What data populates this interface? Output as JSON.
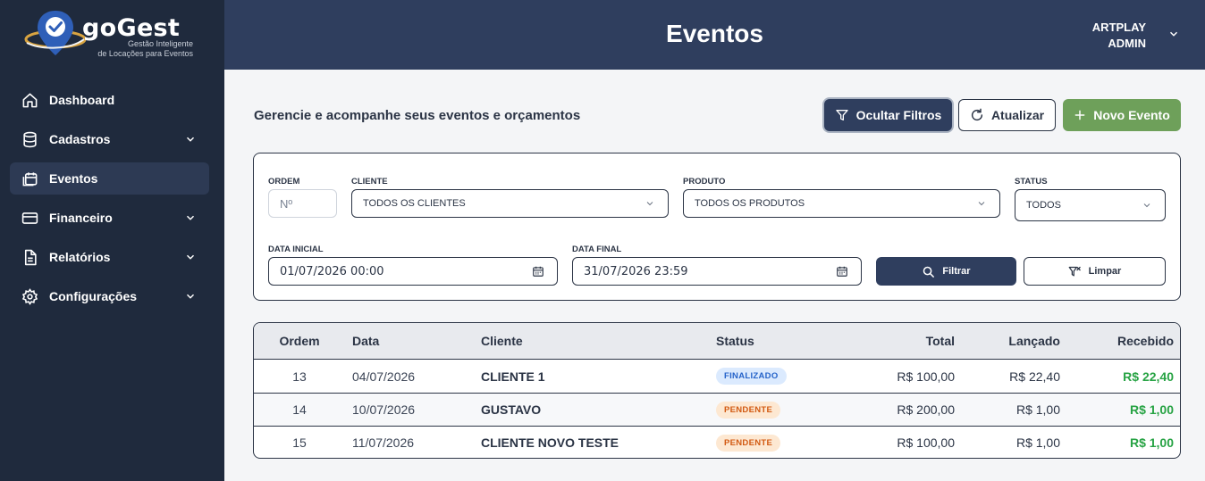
{
  "app": {
    "name": "goGest",
    "tagline_1": "Gestão Inteligente",
    "tagline_2": "de Locações para Eventos"
  },
  "sidebar": {
    "items": [
      {
        "label": "Dashboard",
        "icon": "home-icon"
      },
      {
        "label": "Cadastros",
        "icon": "database-icon",
        "expandable": true
      },
      {
        "label": "Eventos",
        "icon": "calendar-icon",
        "active": true
      },
      {
        "label": "Financeiro",
        "icon": "card-icon",
        "expandable": true
      },
      {
        "label": "Relatórios",
        "icon": "report-icon",
        "expandable": true
      },
      {
        "label": "Configurações",
        "icon": "gear-icon",
        "expandable": true
      }
    ]
  },
  "header": {
    "title": "Eventos",
    "user_name": "ARTPLAY",
    "user_role": "ADMIN"
  },
  "toolbar": {
    "subtitle": "Gerencie e acompanhe seus eventos e orçamentos",
    "hide_filters_label": "Ocultar Filtros",
    "refresh_label": "Atualizar",
    "new_event_label": "Novo Evento"
  },
  "filters": {
    "order_label": "ORDEM",
    "order_placeholder": "Nº",
    "client_label": "CLIENTE",
    "client_value": "TODOS OS CLIENTES",
    "product_label": "PRODUTO",
    "product_value": "TODOS OS PRODUTOS",
    "status_label": "STATUS",
    "status_value": "TODOS",
    "start_label": "DATA INICIAL",
    "start_value": "01/07/2026 00:00",
    "end_label": "DATA FINAL",
    "end_value": "31/07/2026 23:59",
    "filter_button": "Filtrar",
    "clear_button": "Limpar"
  },
  "table": {
    "headers": [
      "Ordem",
      "Data",
      "Cliente",
      "Status",
      "Total",
      "Lançado",
      "Recebido"
    ],
    "rows": [
      {
        "ordem": "13",
        "data": "04/07/2026",
        "cliente": "CLIENTE 1",
        "status": "FINALIZADO",
        "total": "R$ 100,00",
        "lancado": "R$ 22,40",
        "recebido": "R$ 22,40"
      },
      {
        "ordem": "14",
        "data": "10/07/2026",
        "cliente": "GUSTAVO",
        "status": "PENDENTE",
        "total": "R$ 200,00",
        "lancado": "R$ 1,00",
        "recebido": "R$ 1,00"
      },
      {
        "ordem": "15",
        "data": "11/07/2026",
        "cliente": "CLIENTE NOVO TESTE",
        "status": "PENDENTE",
        "total": "R$ 100,00",
        "lancado": "R$ 1,00",
        "recebido": "R$ 1,00"
      }
    ]
  },
  "colors": {
    "sidebar_bg": "#1f2a3d",
    "header_bg": "#2f3e5e",
    "accent_green": "#6ea05a",
    "received_green": "#27a344",
    "badge_finalizado_bg": "#dbeafe",
    "badge_finalizado_fg": "#2563c9",
    "badge_pendente_bg": "#fde8d2",
    "badge_pendente_fg": "#d25a12"
  }
}
